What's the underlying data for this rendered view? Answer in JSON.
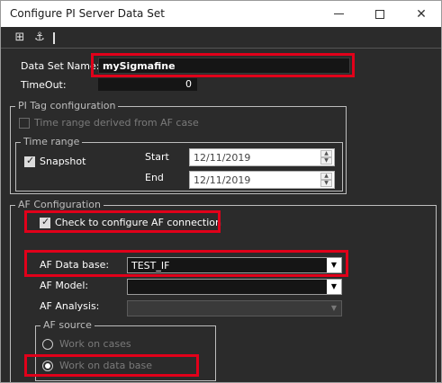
{
  "window": {
    "title": "Configure PI Server Data Set"
  },
  "toolbar": {
    "icons": [
      "binary-icon",
      "anchor-icon"
    ]
  },
  "dataset": {
    "name_label": "Data Set Name:",
    "name_value": "mySigmafine",
    "timeout_label": "TimeOut:",
    "timeout_value": "0"
  },
  "pi_tag": {
    "group_title": "PI Tag configuration",
    "af_case_label": "Time range derived from AF case",
    "af_case_checked": false,
    "time_range": {
      "group_title": "Time range",
      "snapshot_label": "Snapshot",
      "snapshot_checked": true,
      "start_label": "Start",
      "start_value": "12/11/2019",
      "end_label": "End",
      "end_value": "12/11/2019"
    }
  },
  "af": {
    "group_title": "AF Configuration",
    "connect_label": "Check to configure AF connection",
    "connect_checked": true,
    "database_label": "AF Data base:",
    "database_value": "TEST_IF",
    "model_label": "AF Model:",
    "model_value": "",
    "analysis_label": "AF Analysis:",
    "analysis_value": "",
    "source": {
      "group_title": "AF source",
      "cases_label": "Work on cases",
      "database_label": "Work on data base",
      "selected": "database"
    }
  },
  "colors": {
    "highlight": "#e1001a",
    "background": "#2b2b2b"
  }
}
